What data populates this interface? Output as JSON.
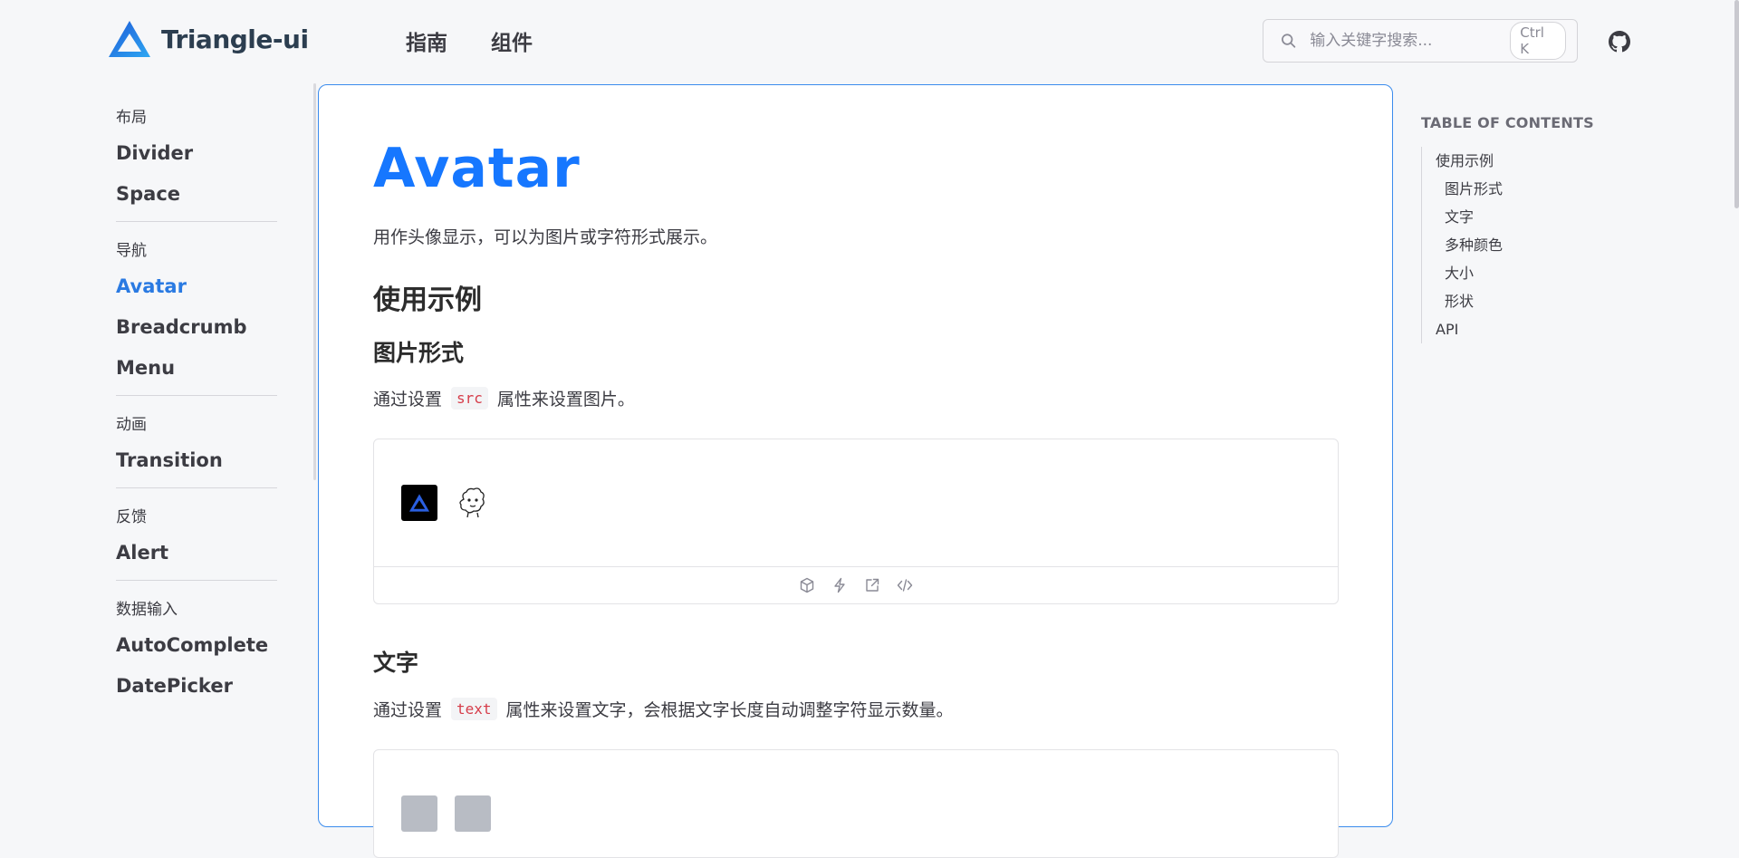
{
  "header": {
    "logo_text": "Triangle-ui",
    "nav": [
      "指南",
      "组件"
    ],
    "search": {
      "placeholder": "输入关键字搜索...",
      "shortcut": "Ctrl K"
    }
  },
  "sidebar": {
    "groups": [
      {
        "title": "布局",
        "items": [
          "Divider",
          "Space"
        ]
      },
      {
        "title": "导航",
        "items": [
          "Avatar",
          "Breadcrumb",
          "Menu"
        ]
      },
      {
        "title": "动画",
        "items": [
          "Transition"
        ]
      },
      {
        "title": "反馈",
        "items": [
          "Alert"
        ]
      },
      {
        "title": "数据输入",
        "items": [
          "AutoComplete",
          "DatePicker"
        ]
      }
    ],
    "active_item": "Avatar"
  },
  "main": {
    "title": "Avatar",
    "description": "用作头像显示，可以为图片或字符形式展示。",
    "section_title": "使用示例",
    "image_section": {
      "title": "图片形式",
      "text_before": "通过设置",
      "code": "src",
      "text_after": "属性来设置图片。"
    },
    "text_section": {
      "title": "文字",
      "text_before": "通过设置",
      "code": "text",
      "text_after": "属性来设置文字，会根据文字长度自动调整字符显示数量。"
    },
    "demo_tools": [
      "cube-icon",
      "lightning-icon",
      "external-link-icon",
      "code-icon"
    ]
  },
  "toc": {
    "title": "TABLE OF CONTENTS",
    "items": [
      {
        "label": "使用示例",
        "level": 1
      },
      {
        "label": "图片形式",
        "level": 2
      },
      {
        "label": "文字",
        "level": 2
      },
      {
        "label": "多种颜色",
        "level": 2
      },
      {
        "label": "大小",
        "level": 2
      },
      {
        "label": "形状",
        "level": 2
      },
      {
        "label": "API",
        "level": 1
      }
    ]
  },
  "colors": {
    "accent": "#1677ff",
    "active_link": "#2a7ae2",
    "code_text": "#d63d4a",
    "card_border": "#3b8ced"
  }
}
